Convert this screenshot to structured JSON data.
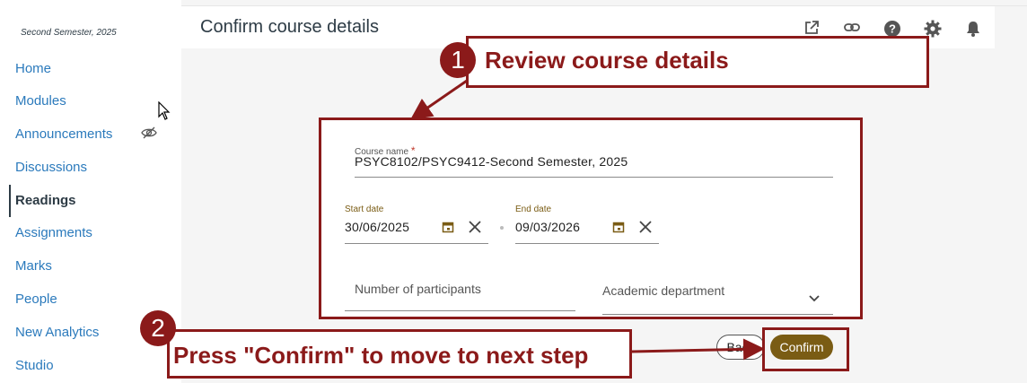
{
  "sidebar": {
    "term": "Second Semester, 2025",
    "items": [
      {
        "label": "Home"
      },
      {
        "label": "Modules"
      },
      {
        "label": "Announcements"
      },
      {
        "label": "Discussions"
      },
      {
        "label": "Readings"
      },
      {
        "label": "Assignments"
      },
      {
        "label": "Marks"
      },
      {
        "label": "People"
      },
      {
        "label": "New Analytics"
      },
      {
        "label": "Studio"
      }
    ],
    "active": "Readings"
  },
  "header": {
    "title": "Confirm course details",
    "icons": [
      "external-link-icon",
      "link-icon",
      "help-icon",
      "gear-icon",
      "bell-icon"
    ]
  },
  "form": {
    "course_name_label": "Course name",
    "required_mark": "*",
    "course_name_value": "PSYC8102/PSYC9412-Second Semester, 2025",
    "start_date_label": "Start date",
    "start_date_value": "30/06/2025",
    "end_date_label": "End date",
    "end_date_value": "09/03/2026",
    "participants_placeholder": "Number of participants",
    "department_placeholder": "Academic department"
  },
  "buttons": {
    "back": "Back",
    "confirm": "Confirm"
  },
  "annotations": {
    "step1_number": "1",
    "step1_text": "Review course details",
    "step2_number": "2",
    "step2_text": "Press \"Confirm\" to move to next step"
  },
  "colors": {
    "annotation": "#8b1a1a",
    "link": "#2b7abc",
    "accent_gold": "#7a5c14"
  }
}
